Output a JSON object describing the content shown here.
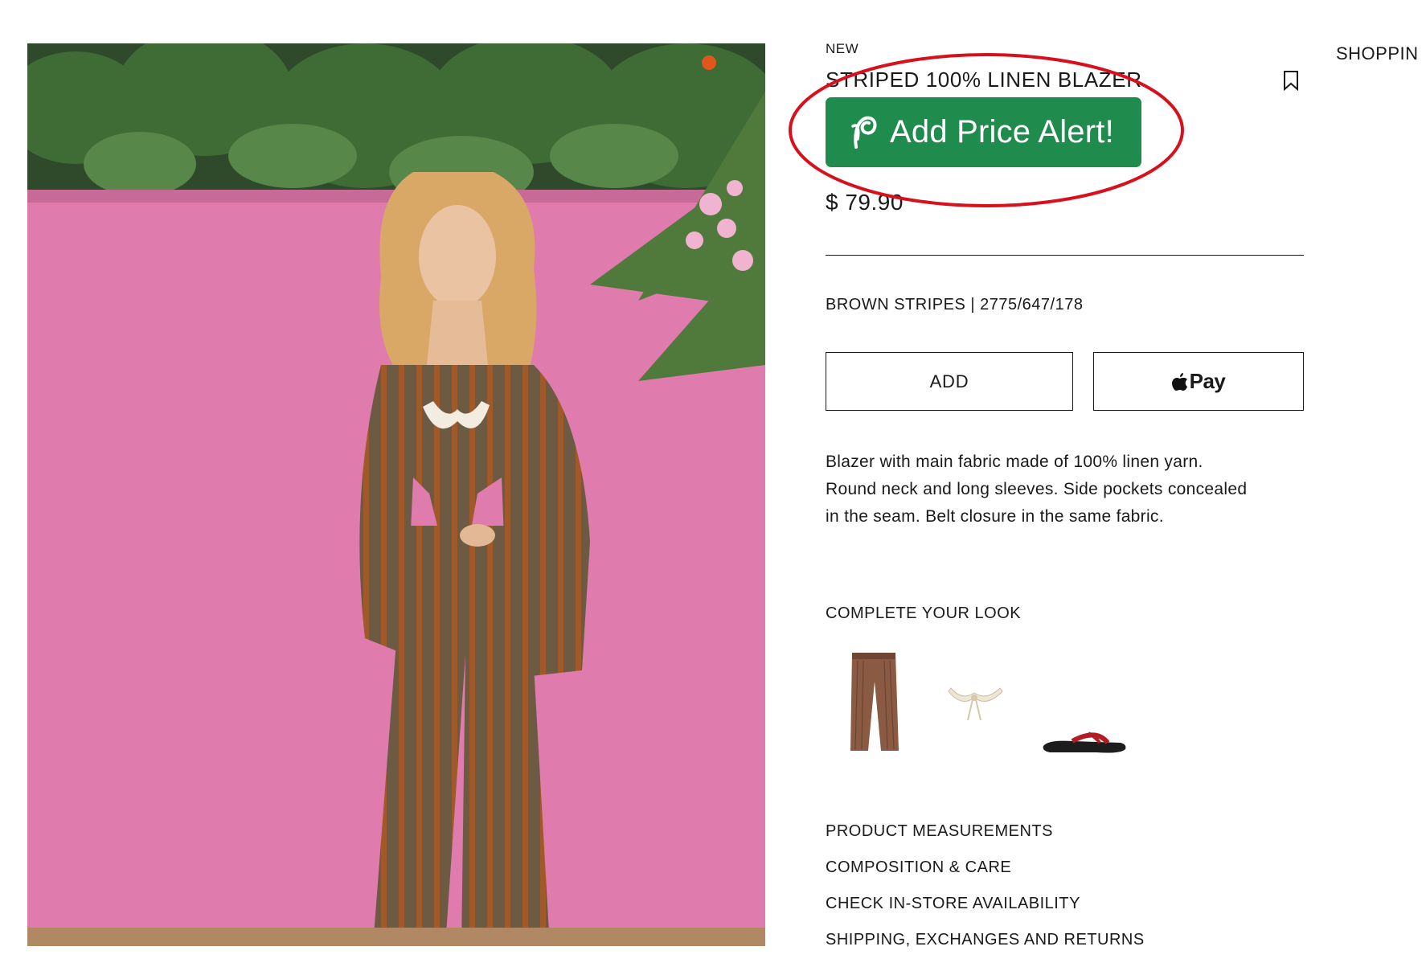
{
  "header": {
    "shopping_bag_label": "SHOPPIN"
  },
  "product": {
    "tag": "NEW",
    "title": "STRIPED 100% LINEN BLAZER",
    "price": "$ 79.90",
    "variant": "BROWN STRIPES | 2775/647/178",
    "description": [
      "Blazer with main fabric made of 100% linen yarn.",
      "Round neck and long sleeves. Side pockets concealed",
      "in the seam. Belt closure in the same fabric."
    ]
  },
  "price_alert": {
    "label": "Add Price Alert!",
    "color": "#1f8b4c",
    "highlight_color": "#d8101c"
  },
  "actions": {
    "add_label": "ADD",
    "pay_label": "Pay"
  },
  "complete_look": {
    "title": "COMPLETE YOUR LOOK",
    "items": [
      "trousers-thumbnail",
      "bikini-top-thumbnail",
      "flip-flop-thumbnail"
    ]
  },
  "info_links": [
    "PRODUCT MEASUREMENTS",
    "COMPOSITION & CARE",
    "CHECK IN-STORE AVAILABILITY",
    "SHIPPING, EXCHANGES AND RETURNS"
  ],
  "icons": {
    "bookmark": "bookmark-icon",
    "apple": "apple-logo-icon",
    "alert": "price-alert-logo-icon"
  }
}
